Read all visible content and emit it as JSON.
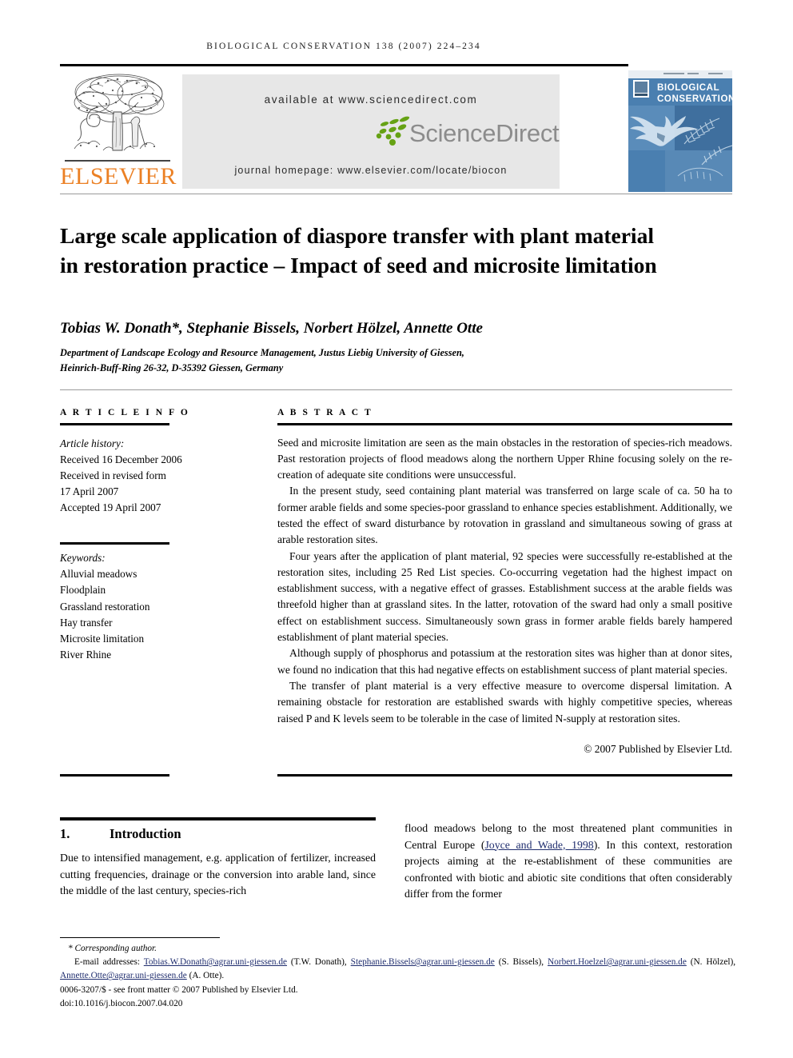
{
  "running_head": "BIOLOGICAL CONSERVATION 138 (2007) 224–234",
  "masthead": {
    "publisher_name": "ELSEVIER",
    "available_at": "available at www.sciencedirect.com",
    "sciencedirect_wordmark": "ScienceDirect",
    "journal_homepage": "journal homepage: www.elsevier.com/locate/biocon",
    "cover_title_line1": "BIOLOGICAL",
    "cover_title_line2": "CONSERVATION",
    "colors": {
      "elsevier_orange": "#eb8024",
      "sciencedirect_green": "#66a214",
      "sciencedirect_gray": "#8c8c8c",
      "banner_gray": "#e7e7e7",
      "cover_blue": "#3f78ab",
      "link_blue": "#1f2d6e"
    }
  },
  "article": {
    "title": "Large scale application of diaspore transfer with plant material in restoration practice – Impact of seed and microsite limitation",
    "authors": "Tobias W. Donath*, Stephanie Bissels, Norbert Hölzel, Annette Otte",
    "affiliation_line1": "Department of Landscape Ecology and Resource Management, Justus Liebig University of Giessen,",
    "affiliation_line2": "Heinrich-Buff-Ring 26-32, D-35392 Giessen, Germany"
  },
  "article_info": {
    "heading": "A R T I C L E   I N F O",
    "history_label": "Article history:",
    "history": [
      "Received 16 December 2006",
      "Received in revised form",
      "17 April 2007",
      "Accepted 19 April 2007"
    ],
    "keywords_label": "Keywords:",
    "keywords": [
      "Alluvial meadows",
      "Floodplain",
      "Grassland restoration",
      "Hay transfer",
      "Microsite limitation",
      "River Rhine"
    ]
  },
  "abstract": {
    "heading": "A B S T R A C T",
    "paragraphs": [
      "Seed and microsite limitation are seen as the main obstacles in the restoration of species-rich meadows. Past restoration projects of flood meadows along the northern Upper Rhine focusing solely on the re-creation of adequate site conditions were unsuccessful.",
      "In the present study, seed containing plant material was transferred on large scale of ca. 50 ha to former arable fields and some species-poor grassland to enhance species establishment. Additionally, we tested the effect of sward disturbance by rotovation in grassland and simultaneous sowing of grass at arable restoration sites.",
      "Four years after the application of plant material, 92 species were successfully re-established at the restoration sites, including 25 Red List species. Co-occurring vegetation had the highest impact on establishment success, with a negative effect of grasses. Establishment success at the arable fields was threefold higher than at grassland sites. In the latter, rotovation of the sward had only a small positive effect on establishment success. Simultaneously sown grass in former arable fields barely hampered establishment of plant material species.",
      "Although supply of phosphorus and potassium at the restoration sites was higher than at donor sites, we found no indication that this had negative effects on establishment success of plant material species.",
      "The transfer of plant material is a very effective measure to overcome dispersal limitation. A remaining obstacle for restoration are established swards with highly competitive species, whereas raised P and K levels seem to be tolerable in the case of limited N-supply at restoration sites."
    ],
    "copyright": "© 2007 Published by Elsevier Ltd."
  },
  "introduction": {
    "number": "1.",
    "heading": "Introduction",
    "left_column": "Due to intensified management, e.g. application of fertilizer, increased cutting frequencies, drainage or the conversion into arable land, since the middle of the last century, species-rich",
    "right_column_pre": "flood meadows belong to the most threatened plant communities in Central Europe (",
    "right_column_citation": "Joyce and Wade, 1998",
    "right_column_post": "). In this context, restoration projects aiming at the re-establishment of these communities are confronted with biotic and abiotic site conditions that often considerably differ from the former"
  },
  "footnote": {
    "corresponding": "* Corresponding author.",
    "emails_label": "E-mail addresses:",
    "emails": [
      {
        "address": "Tobias.W.Donath@agrar.uni-giessen.de",
        "person": "(T.W. Donath),"
      },
      {
        "address": "Stephanie.Bissels@agrar.uni-giessen.de",
        "person": "(S. Bissels),"
      },
      {
        "address": "Norbert.Hoelzel@agrar.uni-giessen.de",
        "person": "(N. Hölzel),"
      },
      {
        "address": "Annette.Otte@agrar.uni-giessen.de",
        "person": "(A. Otte)."
      }
    ],
    "issn_line": "0006-3207/$ - see front matter © 2007 Published by Elsevier Ltd.",
    "doi_line": "doi:10.1016/j.biocon.2007.04.020"
  }
}
